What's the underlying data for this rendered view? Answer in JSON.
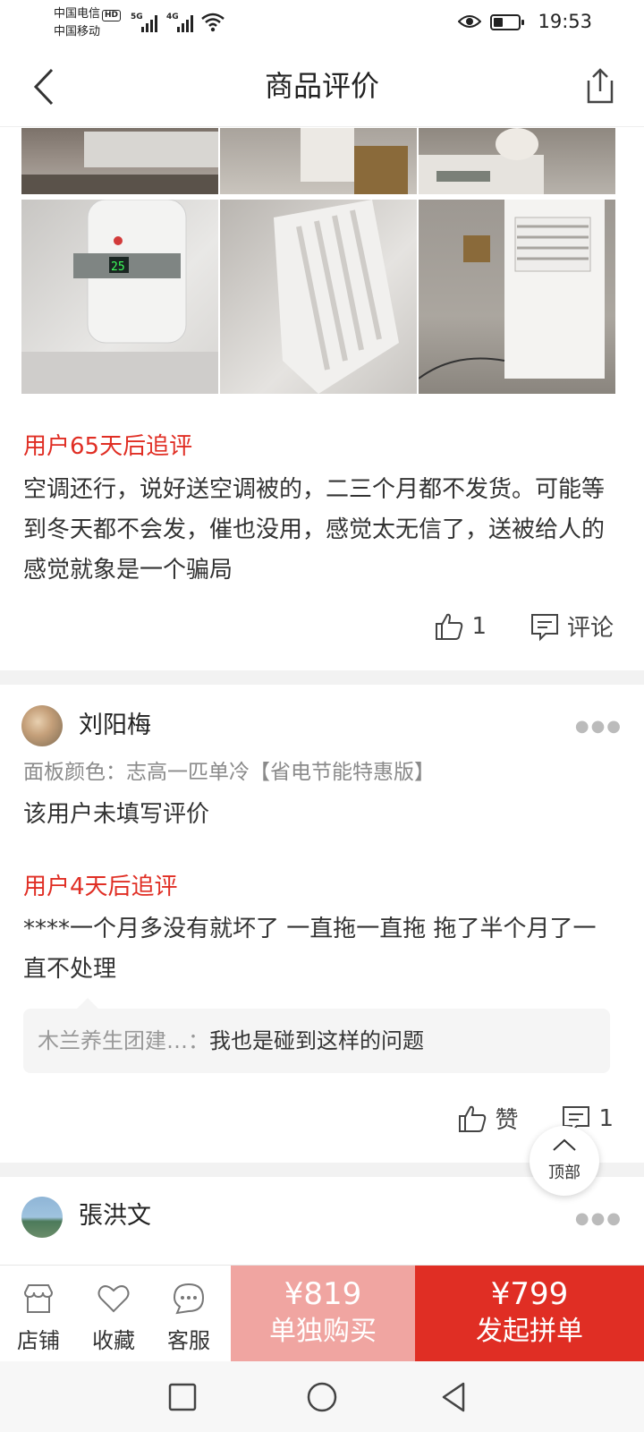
{
  "status_bar": {
    "carrier_1": "中国电信",
    "hd_badge": "HD",
    "carrier_2": "中国移动",
    "net_1": "5G",
    "net_2": "4G",
    "time": "19:53"
  },
  "header": {
    "title": "商品评价",
    "back_icon": "chevron-left-icon",
    "share_icon": "share-icon"
  },
  "review_1": {
    "follow_up_label": "用户65天后追评",
    "follow_up_text": "空调还行，说好送空调被的，二三个月都不发货。可能等到冬天都不会发，催也没用，感觉太无信了，送被给人的感觉就象是一个骗局",
    "likes": "1",
    "comment_label": "评论",
    "display_reading": "25"
  },
  "review_2": {
    "username": "刘阳梅",
    "spec": "面板颜色：志高一匹单冷【省电节能特惠版】",
    "text": "该用户未填写评价",
    "follow_up_label": "用户4天后追评",
    "follow_up_text": "****一个月多没有就坏了  一直拖一直拖  拖了半个月了一直不处理",
    "reply_user": "木兰养生团建…：",
    "reply_text": "我也是碰到这样的问题",
    "like_label": "赞",
    "comments": "1"
  },
  "review_3": {
    "username": "張洪文"
  },
  "to_top": {
    "label": "顶部"
  },
  "bottom_bar": {
    "shop_label": "店铺",
    "fav_label": "收藏",
    "service_label": "客服",
    "single_price": "¥819",
    "single_label": "单独购买",
    "group_price": "¥799",
    "group_label": "发起拼单"
  },
  "colors": {
    "accent_red": "#e02e24",
    "light_red": "#f0a5a1"
  }
}
